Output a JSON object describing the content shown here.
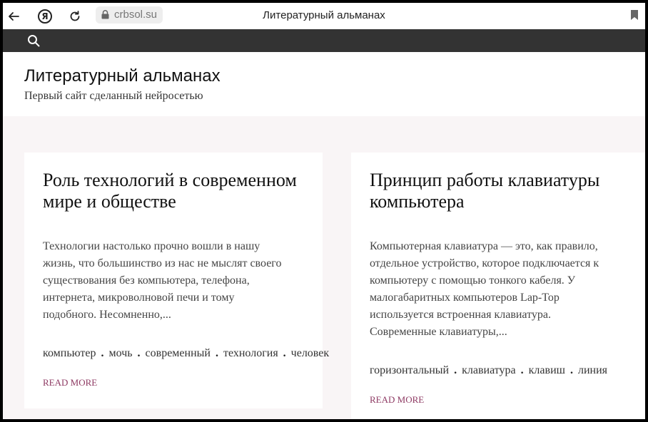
{
  "browser": {
    "address": "crbsol.su",
    "tab_title": "Литературный альманах",
    "yandex_glyph": "Я"
  },
  "header": {
    "site_title": "Литературный альманах",
    "site_description": "Первый сайт сделанный нейросетью"
  },
  "posts": [
    {
      "title": "Роль технологий в современном мире и обществе",
      "excerpt": "Технологии настолько прочно вошли в нашу жизнь, что большинство из нас не мыслят своего существования без компьютера, телефона, интернета, микроволновой печи и тому подобного. Несомненно,...",
      "tags": [
        "компьютер",
        "мочь",
        "современный",
        "технология",
        "человек"
      ],
      "read_more": "READ MORE"
    },
    {
      "title": "Принцип работы клавиатуры компьютера",
      "excerpt": "Компьютерная клавиатура — это, как правило, отдельное устройство, которое подключается к компьютеру с помощью тонкого кабеля. У малогабаритных компьютеров Lap-Top используется встроенная клавиатура. Современные клавиатуры,...",
      "tags": [
        "горизонтальный",
        "клавиатура",
        "клавиш",
        "линия"
      ],
      "read_more": "READ MORE"
    }
  ],
  "tag_separator": ".",
  "colors": {
    "nav_bar": "#333333",
    "content_bg": "#f9f5f6",
    "read_more": "#8e3a63"
  }
}
